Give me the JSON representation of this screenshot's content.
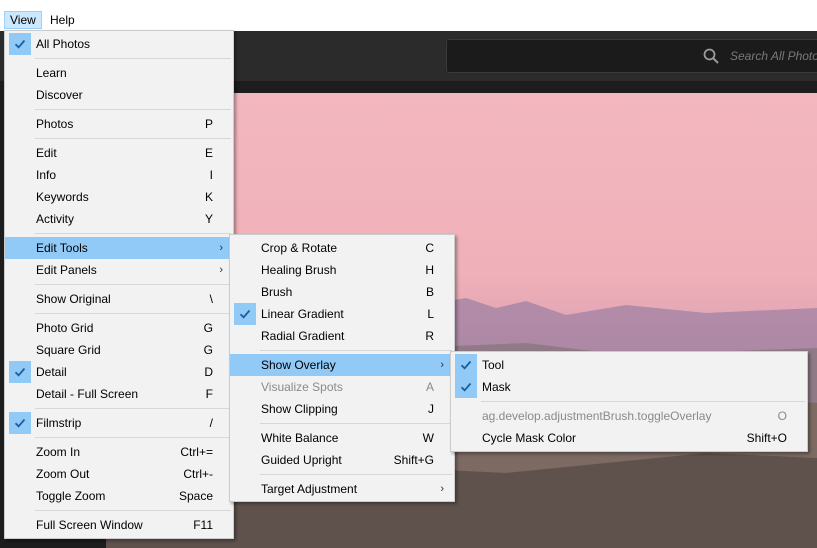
{
  "menubar": {
    "view": "View",
    "help": "Help"
  },
  "search": {
    "placeholder": "Search All Photos"
  },
  "view_menu": {
    "items": [
      {
        "label": "All Photos",
        "checked": true
      },
      "sep",
      {
        "label": "Learn"
      },
      {
        "label": "Discover"
      },
      "sep",
      {
        "label": "Photos",
        "shortcut": "P"
      },
      "sep",
      {
        "label": "Edit",
        "shortcut": "E"
      },
      {
        "label": "Info",
        "shortcut": "I"
      },
      {
        "label": "Keywords",
        "shortcut": "K"
      },
      {
        "label": "Activity",
        "shortcut": "Y"
      },
      "sep",
      {
        "label": "Edit Tools",
        "submenu": true,
        "highlighted": true
      },
      {
        "label": "Edit Panels",
        "submenu": true
      },
      "sep",
      {
        "label": "Show Original",
        "shortcut": "\\"
      },
      "sep",
      {
        "label": "Photo Grid",
        "shortcut": "G"
      },
      {
        "label": "Square Grid",
        "shortcut": "G"
      },
      {
        "label": "Detail",
        "shortcut": "D",
        "checked": true
      },
      {
        "label": "Detail - Full Screen",
        "shortcut": "F"
      },
      "sep",
      {
        "label": "Filmstrip",
        "shortcut": "/",
        "checked": true
      },
      "sep",
      {
        "label": "Zoom In",
        "shortcut": "Ctrl+="
      },
      {
        "label": "Zoom Out",
        "shortcut": "Ctrl+-"
      },
      {
        "label": "Toggle Zoom",
        "shortcut": "Space"
      },
      "sep",
      {
        "label": "Full Screen Window",
        "shortcut": "F11"
      }
    ]
  },
  "edit_tools_menu": {
    "items": [
      {
        "label": "Crop & Rotate",
        "shortcut": "C"
      },
      {
        "label": "Healing Brush",
        "shortcut": "H"
      },
      {
        "label": "Brush",
        "shortcut": "B"
      },
      {
        "label": "Linear Gradient",
        "shortcut": "L",
        "checked": true
      },
      {
        "label": "Radial Gradient",
        "shortcut": "R"
      },
      "sep",
      {
        "label": "Show Overlay",
        "submenu": true,
        "highlighted": true
      },
      {
        "label": "Visualize Spots",
        "shortcut": "A",
        "disabled": true
      },
      {
        "label": "Show Clipping",
        "shortcut": "J"
      },
      "sep",
      {
        "label": "White Balance",
        "shortcut": "W"
      },
      {
        "label": "Guided Upright",
        "shortcut": "Shift+G"
      },
      "sep",
      {
        "label": "Target Adjustment",
        "submenu": true
      }
    ]
  },
  "show_overlay_menu": {
    "items": [
      {
        "label": "Tool",
        "checked": true
      },
      {
        "label": "Mask",
        "checked": true
      },
      "sep",
      {
        "label": "ag.develop.adjustmentBrush.toggleOverlay",
        "shortcut": "O",
        "disabled": true
      },
      {
        "label": "Cycle Mask Color",
        "shortcut": "Shift+O"
      }
    ]
  }
}
